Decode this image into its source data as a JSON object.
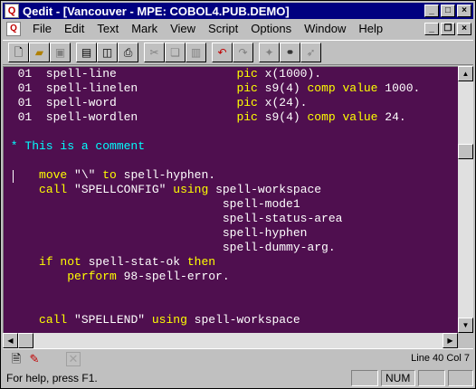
{
  "window": {
    "title": "Qedit - [Vancouver - MPE: COBOL4.PUB.DEMO]",
    "app_icon": "Q"
  },
  "menu": {
    "items": [
      "File",
      "Edit",
      "Text",
      "Mark",
      "View",
      "Script",
      "Options",
      "Window",
      "Help"
    ]
  },
  "toolbar": {
    "buttons": [
      "new-file-icon",
      "open-folder-icon",
      "save-icon",
      "print-preview-icon",
      "compare-icon",
      "print-icon",
      "cut-icon",
      "copy-icon",
      "paste-icon",
      "undo-icon",
      "redo-icon",
      "find-icon",
      "binoculars-icon",
      "find-next-icon"
    ]
  },
  "editor": {
    "lines": [
      [
        {
          "t": "  01  spell-line                 ",
          "c": "w"
        },
        {
          "t": "pic",
          "c": "y"
        },
        {
          "t": " x(1000).",
          "c": "w"
        }
      ],
      [
        {
          "t": "  01  spell-linelen              ",
          "c": "w"
        },
        {
          "t": "pic",
          "c": "y"
        },
        {
          "t": " s9(4) ",
          "c": "w"
        },
        {
          "t": "comp value",
          "c": "y"
        },
        {
          "t": " 1000.",
          "c": "w"
        }
      ],
      [
        {
          "t": "  01  spell-word                 ",
          "c": "w"
        },
        {
          "t": "pic",
          "c": "y"
        },
        {
          "t": " x(24).",
          "c": "w"
        }
      ],
      [
        {
          "t": "  01  spell-wordlen              ",
          "c": "w"
        },
        {
          "t": "pic",
          "c": "y"
        },
        {
          "t": " s9(4) ",
          "c": "w"
        },
        {
          "t": "comp value",
          "c": "y"
        },
        {
          "t": " 24.",
          "c": "w"
        }
      ],
      [],
      [
        {
          "t": " * This is a comment",
          "c": "c"
        }
      ],
      [],
      [
        {
          "t": "     ",
          "c": "w"
        },
        {
          "t": "move",
          "c": "y"
        },
        {
          "t": " \"\\\" ",
          "c": "w"
        },
        {
          "t": "to",
          "c": "y"
        },
        {
          "t": " spell-hyphen.",
          "c": "w"
        }
      ],
      [
        {
          "t": "     ",
          "c": "w"
        },
        {
          "t": "call",
          "c": "y"
        },
        {
          "t": " \"SPELLCONFIG\" ",
          "c": "w"
        },
        {
          "t": "using",
          "c": "y"
        },
        {
          "t": " spell-workspace",
          "c": "w"
        }
      ],
      [
        {
          "t": "                               spell-mode1",
          "c": "w"
        }
      ],
      [
        {
          "t": "                               spell-status-area",
          "c": "w"
        }
      ],
      [
        {
          "t": "                               spell-hyphen",
          "c": "w"
        }
      ],
      [
        {
          "t": "                               spell-dummy-arg.",
          "c": "w"
        }
      ],
      [
        {
          "t": "     ",
          "c": "w"
        },
        {
          "t": "if not",
          "c": "y"
        },
        {
          "t": " spell-stat-ok ",
          "c": "w"
        },
        {
          "t": "then",
          "c": "y"
        }
      ],
      [
        {
          "t": "         ",
          "c": "w"
        },
        {
          "t": "perform",
          "c": "y"
        },
        {
          "t": " 98-spell-error.",
          "c": "w"
        }
      ],
      [],
      [],
      [
        {
          "t": "     ",
          "c": "w"
        },
        {
          "t": "call",
          "c": "y"
        },
        {
          "t": " \"SPELLEND\" ",
          "c": "w"
        },
        {
          "t": "using",
          "c": "y"
        },
        {
          "t": " spell-workspace",
          "c": "w"
        }
      ]
    ]
  },
  "position": {
    "line_col": "Line 40 Col 7"
  },
  "status": {
    "help": "For help, press F1.",
    "num": "NUM"
  }
}
